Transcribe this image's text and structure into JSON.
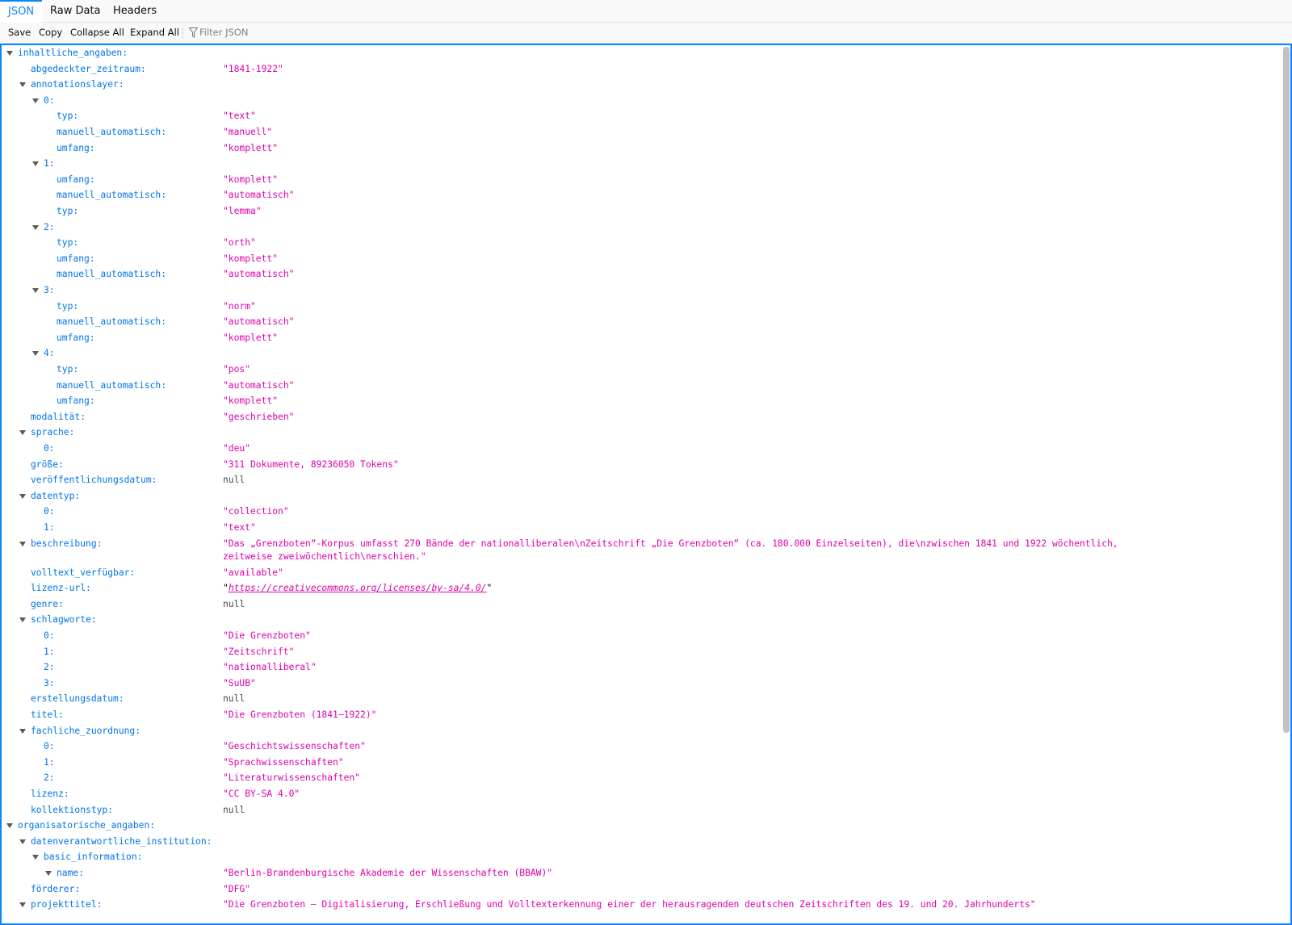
{
  "tabs": [
    {
      "label": "JSON",
      "active": true
    },
    {
      "label": "Raw Data",
      "active": false
    },
    {
      "label": "Headers",
      "active": false
    }
  ],
  "toolbar": {
    "save": "Save",
    "copy": "Copy",
    "collapse_all": "Collapse All",
    "expand_all": "Expand All",
    "filter_placeholder": "Filter JSON"
  },
  "accent_color": "#0a84ff",
  "key_color": "#0074e8",
  "string_color": "#dd00a9",
  "rows": [
    {
      "depth": 0,
      "key": "inhaltliche_angaben:",
      "expandable": true
    },
    {
      "depth": 1,
      "key": "abgedeckter_zeitraum:",
      "value": "\"1841-1922\"",
      "type": "str"
    },
    {
      "depth": 1,
      "key": "annotationslayer:",
      "expandable": true
    },
    {
      "depth": 2,
      "key": "0:",
      "expandable": true
    },
    {
      "depth": 3,
      "key": "typ:",
      "value": "\"text\"",
      "type": "str"
    },
    {
      "depth": 3,
      "key": "manuell_automatisch:",
      "value": "\"manuell\"",
      "type": "str"
    },
    {
      "depth": 3,
      "key": "umfang:",
      "value": "\"komplett\"",
      "type": "str"
    },
    {
      "depth": 2,
      "key": "1:",
      "expandable": true
    },
    {
      "depth": 3,
      "key": "umfang:",
      "value": "\"komplett\"",
      "type": "str"
    },
    {
      "depth": 3,
      "key": "manuell_automatisch:",
      "value": "\"automatisch\"",
      "type": "str"
    },
    {
      "depth": 3,
      "key": "typ:",
      "value": "\"lemma\"",
      "type": "str"
    },
    {
      "depth": 2,
      "key": "2:",
      "expandable": true
    },
    {
      "depth": 3,
      "key": "typ:",
      "value": "\"orth\"",
      "type": "str"
    },
    {
      "depth": 3,
      "key": "umfang:",
      "value": "\"komplett\"",
      "type": "str"
    },
    {
      "depth": 3,
      "key": "manuell_automatisch:",
      "value": "\"automatisch\"",
      "type": "str"
    },
    {
      "depth": 2,
      "key": "3:",
      "expandable": true
    },
    {
      "depth": 3,
      "key": "typ:",
      "value": "\"norm\"",
      "type": "str"
    },
    {
      "depth": 3,
      "key": "manuell_automatisch:",
      "value": "\"automatisch\"",
      "type": "str"
    },
    {
      "depth": 3,
      "key": "umfang:",
      "value": "\"komplett\"",
      "type": "str"
    },
    {
      "depth": 2,
      "key": "4:",
      "expandable": true
    },
    {
      "depth": 3,
      "key": "typ:",
      "value": "\"pos\"",
      "type": "str"
    },
    {
      "depth": 3,
      "key": "manuell_automatisch:",
      "value": "\"automatisch\"",
      "type": "str"
    },
    {
      "depth": 3,
      "key": "umfang:",
      "value": "\"komplett\"",
      "type": "str"
    },
    {
      "depth": 1,
      "key": "modalität:",
      "value": "\"geschrieben\"",
      "type": "str"
    },
    {
      "depth": 1,
      "key": "sprache:",
      "expandable": true
    },
    {
      "depth": 2,
      "key": "0:",
      "value": "\"deu\"",
      "type": "str"
    },
    {
      "depth": 1,
      "key": "größe:",
      "value": "\"311 Dokumente, 89236050 Tokens\"",
      "type": "str"
    },
    {
      "depth": 1,
      "key": "veröffentlichungsdatum:",
      "value": "null",
      "type": "null"
    },
    {
      "depth": 1,
      "key": "datentyp:",
      "expandable": true
    },
    {
      "depth": 2,
      "key": "0:",
      "value": "\"collection\"",
      "type": "str"
    },
    {
      "depth": 2,
      "key": "1:",
      "value": "\"text\"",
      "type": "str"
    },
    {
      "depth": 1,
      "key": "beschreibung:",
      "expandable": true,
      "value": "\"Das „Grenzboten“-Korpus umfasst 270 Bände der nationalliberalen\\nZeitschrift „Die Grenzboten“ (ca. 180.000 Einzelseiten), die\\nzwischen 1841 und 1922 wöchentlich, zeitweise zweiwöchentlich\\nerschien.\"",
      "type": "str",
      "tall": true
    },
    {
      "depth": 1,
      "key": "volltext_verfügbar:",
      "value": "\"available\"",
      "type": "str"
    },
    {
      "depth": 1,
      "key": "lizenz-url:",
      "value": "https://creativecommons.org/licenses/by-sa/4.0/",
      "type": "link"
    },
    {
      "depth": 1,
      "key": "genre:",
      "value": "null",
      "type": "null"
    },
    {
      "depth": 1,
      "key": "schlagworte:",
      "expandable": true
    },
    {
      "depth": 2,
      "key": "0:",
      "value": "\"Die Grenzboten\"",
      "type": "str"
    },
    {
      "depth": 2,
      "key": "1:",
      "value": "\"Zeitschrift\"",
      "type": "str"
    },
    {
      "depth": 2,
      "key": "2:",
      "value": "\"nationalliberal\"",
      "type": "str"
    },
    {
      "depth": 2,
      "key": "3:",
      "value": "\"SuUB\"",
      "type": "str"
    },
    {
      "depth": 1,
      "key": "erstellungsdatum:",
      "value": "null",
      "type": "null"
    },
    {
      "depth": 1,
      "key": "titel:",
      "value": "\"Die Grenzboten (1841–1922)\"",
      "type": "str"
    },
    {
      "depth": 1,
      "key": "fachliche_zuordnung:",
      "expandable": true
    },
    {
      "depth": 2,
      "key": "0:",
      "value": "\"Geschichtswissenschaften\"",
      "type": "str"
    },
    {
      "depth": 2,
      "key": "1:",
      "value": "\"Sprachwissenschaften\"",
      "type": "str"
    },
    {
      "depth": 2,
      "key": "2:",
      "value": "\"Literaturwissenschaften\"",
      "type": "str"
    },
    {
      "depth": 1,
      "key": "lizenz:",
      "value": "\"CC BY-SA 4.0\"",
      "type": "str"
    },
    {
      "depth": 1,
      "key": "kollektionstyp:",
      "value": "null",
      "type": "null"
    },
    {
      "depth": 0,
      "key": "organisatorische_angaben:",
      "expandable": true
    },
    {
      "depth": 1,
      "key": "datenverantwortliche_institution:",
      "expandable": true
    },
    {
      "depth": 2,
      "key": "basic_information:",
      "expandable": true
    },
    {
      "depth": 3,
      "key": "name:",
      "expandable": true,
      "value": "\"Berlin-Brandenburgische Akademie der Wissenschaften (BBAW)\"",
      "type": "str"
    },
    {
      "depth": 1,
      "key": "förderer:",
      "value": "\"DFG\"",
      "type": "str"
    },
    {
      "depth": 1,
      "key": "projekttitel:",
      "expandable": true,
      "value": "\"Die Grenzboten – Digitalisierung, Erschließung und Volltexterkennung einer der herausragenden deutschen Zeitschriften des 19. und 20. Jahrhunderts\"",
      "type": "str"
    }
  ]
}
